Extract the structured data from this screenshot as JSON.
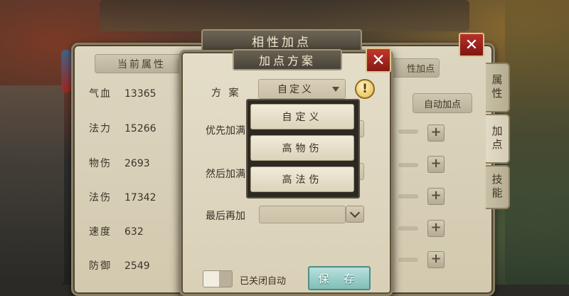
{
  "main_panel": {
    "title": "相性加点",
    "current_attr_tab": "当前属性",
    "right_attr_button": "性加点",
    "auto_button": "自动加点",
    "stats": [
      {
        "label": "气血",
        "value": "13365"
      },
      {
        "label": "法力",
        "value": "15266"
      },
      {
        "label": "物伤",
        "value": "2693"
      },
      {
        "label": "法伤",
        "value": "17342"
      },
      {
        "label": "速度",
        "value": "632"
      },
      {
        "label": "防御",
        "value": "2549"
      }
    ],
    "plus_symbol": "+",
    "side_tabs": [
      "属性",
      "加点",
      "技能"
    ],
    "close_symbol": "✕"
  },
  "dialog": {
    "title": "加点方案",
    "close_symbol": "✕",
    "scheme_label": "方  案",
    "scheme_value": "自定义",
    "info_symbol": "!",
    "first_label": "优先加满",
    "then_label": "然后加满",
    "last_label": "最后再加",
    "dropdown_options": [
      "自定义",
      "高物伤",
      "高法伤"
    ],
    "toggle_label": "已关闭自动",
    "save_button": "保 存"
  },
  "colors": {
    "accent_close": "#b8302a",
    "save_button": "#7fbeb6",
    "panel_bg": "#ddd6c0"
  }
}
